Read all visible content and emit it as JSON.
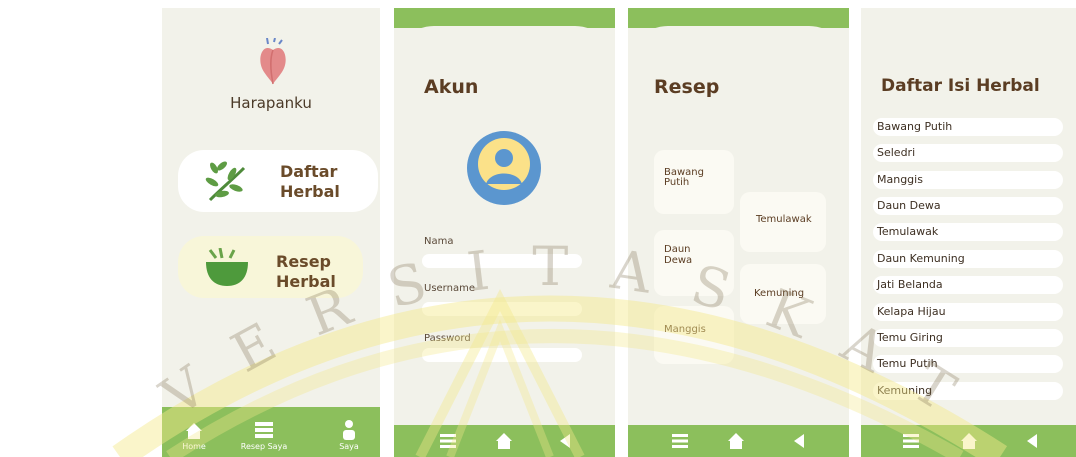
{
  "screen_home": {
    "app_title": "Harapanku",
    "menu": [
      {
        "label_line1": "Daftar",
        "label_line2": "Herbal",
        "icon": "leaf-icon"
      },
      {
        "label_line1": "Resep",
        "label_line2": "Herbal",
        "icon": "mortar-icon"
      }
    ],
    "nav": [
      {
        "label": "Home",
        "icon": "home-icon"
      },
      {
        "label": "Resep Saya",
        "icon": "list-icon"
      },
      {
        "label": "Saya",
        "icon": "person-icon"
      }
    ]
  },
  "screen_account": {
    "title": "Akun",
    "fields": [
      {
        "label": "Nama",
        "value": ""
      },
      {
        "label": "Username",
        "value": ""
      },
      {
        "label": "Password",
        "value": ""
      }
    ]
  },
  "screen_recipes": {
    "title": "Resep",
    "recipes": [
      {
        "line1": "Bawang",
        "line2": "Putih"
      },
      {
        "line1": "Temulawak",
        "line2": ""
      },
      {
        "line1": "Daun",
        "line2": "Dewa"
      },
      {
        "line1": "Kemuning",
        "line2": ""
      },
      {
        "line1": "Manggis",
        "line2": ""
      }
    ]
  },
  "screen_list": {
    "title": "Daftar Isi Herbal",
    "items": [
      "Bawang Putih",
      "Seledri",
      "Manggis",
      "Daun Dewa",
      "Temulawak",
      "Daun Kemuning",
      "Jati Belanda",
      "Kelapa Hijau",
      "Temu Giring",
      "Temu Putih",
      "Kemuning"
    ]
  },
  "watermark": {
    "arc_text": "V E R S I T A S   K A T O"
  },
  "colors": {
    "nav_green": "#8cbf5c",
    "background": "#f2f2ea",
    "title_brown": "#5b3d23",
    "watermark_yellow": "#f3e98a"
  }
}
